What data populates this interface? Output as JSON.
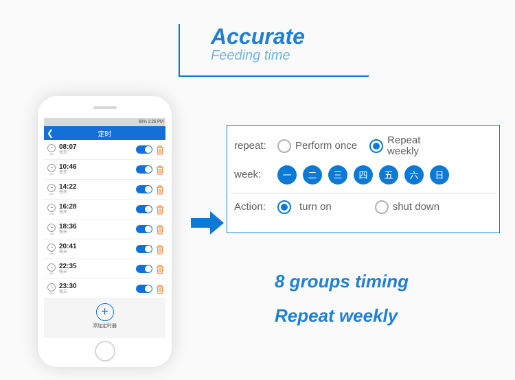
{
  "title": {
    "main": "Accurate",
    "sub": "Feeding time"
  },
  "statusbar": "69% 2:26 PM",
  "nav": {
    "title": "定时"
  },
  "timers": [
    {
      "time": "08:07",
      "sub": "每天"
    },
    {
      "time": "10:46",
      "sub": "每天"
    },
    {
      "time": "14:22",
      "sub": "每天"
    },
    {
      "time": "16:28",
      "sub": "每天"
    },
    {
      "time": "18:36",
      "sub": "每天"
    },
    {
      "time": "20:41",
      "sub": "每天"
    },
    {
      "time": "22:35",
      "sub": "每天"
    },
    {
      "time": "23:30",
      "sub": "每天"
    }
  ],
  "on_label": "ON",
  "add_label": "添加定时器",
  "panel": {
    "repeat_label": "repeat:",
    "perform_once": "Perform once",
    "repeat_weekly": "Repeat\nweekly",
    "week_label": "week:",
    "days": [
      "一",
      "二",
      "三",
      "四",
      "五",
      "六",
      "日"
    ],
    "action_label": "Action:",
    "turn_on": "turn on",
    "shut_down": "shut down"
  },
  "headline1": "8 groups timing",
  "headline2": "Repeat weekly"
}
